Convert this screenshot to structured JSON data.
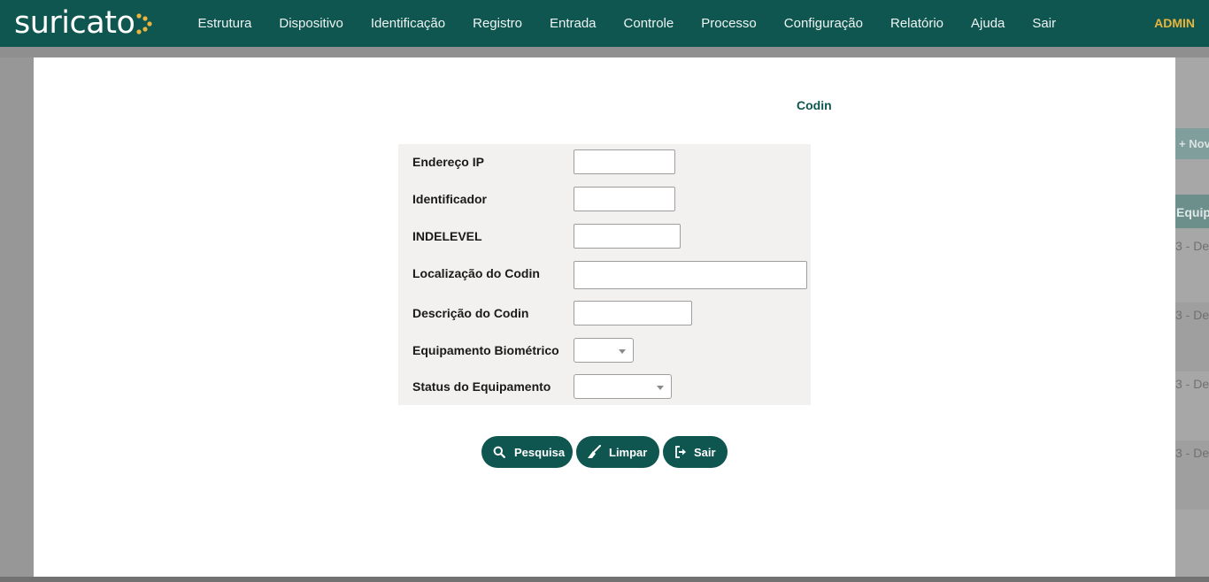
{
  "header": {
    "logo_text": "suricato",
    "menu": [
      "Estrutura",
      "Dispositivo",
      "Identificação",
      "Registro",
      "Entrada",
      "Controle",
      "Processo",
      "Configuração",
      "Relatório",
      "Ajuda",
      "Sair"
    ],
    "user": "ADMIN",
    "colors": {
      "bar": "#0f5650",
      "user": "#e9b53c",
      "logo_dots": "#e9b53c"
    }
  },
  "background_page": {
    "new_button_partial": "+ Nov",
    "column_header_partial": "Equip",
    "row_partials": [
      "3 - De",
      "3 - De",
      "3 - De",
      "3 - De"
    ]
  },
  "modal": {
    "title": "Codin",
    "fields": [
      {
        "label": "Endereço IP",
        "value": ""
      },
      {
        "label": "Identificador",
        "value": ""
      },
      {
        "label": "INDELEVEL",
        "value": ""
      },
      {
        "label": "Localização do Codin",
        "value": ""
      },
      {
        "label": "Descrição do Codin",
        "value": ""
      },
      {
        "label": "Equipamento Biométrico",
        "value": ""
      },
      {
        "label": "Status do Equipamento",
        "value": ""
      }
    ],
    "buttons": {
      "search": "Pesquisa",
      "clear": "Limpar",
      "exit": "Sair"
    },
    "icons": {
      "search": "search-icon",
      "clear": "broom-icon",
      "exit": "sign-out-icon"
    }
  }
}
